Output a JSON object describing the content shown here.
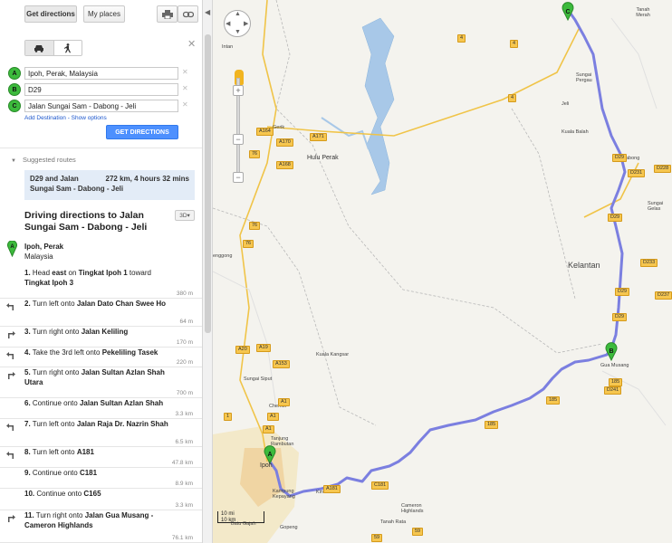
{
  "toolbar": {
    "get_directions_label": "Get directions",
    "my_places_label": "My places"
  },
  "waypoints": [
    {
      "marker": "A",
      "value": "Ipoh, Perak, Malaysia"
    },
    {
      "marker": "B",
      "value": "D29"
    },
    {
      "marker": "C",
      "value": "Jalan Sungai Sam - Dabong - Jeli"
    }
  ],
  "links": {
    "add_destination": "Add Destination",
    "separator": " - ",
    "show_options": "Show options"
  },
  "get_directions_button": "GET DIRECTIONS",
  "suggested": {
    "heading": "Suggested routes",
    "route_name_1": "D29 and Jalan",
    "route_name_2": "Sungai Sam - Dabong - Jeli",
    "route_summary": "272 km, 4 hours 32 mins"
  },
  "directions": {
    "title": "Driving directions to Jalan Sungai Sam - Dabong - Jeli",
    "btn_3d": "3D",
    "start_name": "Ipoh, Perak",
    "start_country": "Malaysia"
  },
  "steps": [
    {
      "num": "1.",
      "html_a": "Head ",
      "b1": "east",
      "html_b": " on ",
      "b2": "Tingkat Ipoh 1",
      "html_c": " toward ",
      "b3": "Tingkat Ipoh 3",
      "dist": "380 m",
      "icon": "none-icon"
    },
    {
      "num": "2.",
      "html_a": "Turn left onto ",
      "b1": "Jalan Dato Chan Swee Ho",
      "dist": "64 m",
      "icon": "turn-left-icon"
    },
    {
      "num": "3.",
      "html_a": "Turn right onto ",
      "b1": "Jalan Keliling",
      "dist": "170 m",
      "icon": "turn-right-icon"
    },
    {
      "num": "4.",
      "html_a": "Take the 3rd left onto ",
      "b1": "Pekeliling Tasek",
      "dist": "220 m",
      "icon": "turn-left-icon"
    },
    {
      "num": "5.",
      "html_a": "Turn right onto ",
      "b1": "Jalan Sultan Azlan Shah Utara",
      "dist": "700 m",
      "icon": "turn-right-icon"
    },
    {
      "num": "6.",
      "html_a": "Continue onto ",
      "b1": "Jalan Sultan Azlan Shah",
      "dist": "3.3 km",
      "icon": "none-icon"
    },
    {
      "num": "7.",
      "html_a": "Turn left onto ",
      "b1": "Jalan Raja Dr. Nazrin Shah",
      "dist": "6.5 km",
      "icon": "turn-left-icon"
    },
    {
      "num": "8.",
      "html_a": "Turn left onto ",
      "b1": "A181",
      "dist": "47.8 km",
      "icon": "turn-left-icon"
    },
    {
      "num": "9.",
      "html_a": "Continue onto ",
      "b1": "C181",
      "dist": "8.9 km",
      "icon": "none-icon"
    },
    {
      "num": "10.",
      "html_a": "Continue onto ",
      "b1": "C165",
      "dist": "3.3 km",
      "icon": "none-icon"
    },
    {
      "num": "11.",
      "html_a": "Turn right onto ",
      "b1": "Jalan Gua Musang - Cameron Highlands",
      "dist": "76.1 km",
      "icon": "turn-right-icon"
    }
  ],
  "map": {
    "labels": {
      "kelantan": "Kelantan",
      "hulu_perak": "Hulu Perak",
      "kuala_kangsar": "Kuala Kangsar",
      "tanah_merah": "Tanah Merah",
      "jeli": "Jeli",
      "sungai_pergau": "Sungai Pergau",
      "kuala_balah": "Kuala Balah",
      "dabong": "Dabong",
      "sungai_gelas": "Sungai Gelas",
      "gua_musang": "Gua Musang",
      "gerik": "Gerik",
      "intan": "Intan",
      "sungai_siput": "Sungai Siput",
      "chemor": "Chemor",
      "tanjung_rambutan": "Tanjung Rambutan",
      "ipoh": "Ipoh",
      "kampung_kepayang": "Kampung Kepayang",
      "kinta": "Kinta",
      "cameron_highlands": "Cameron Highlands",
      "tanah_rata": "Tanah Rata",
      "gopeng": "Gopeng",
      "batu_gajah": "Batu Gajah",
      "enggong": "enggong"
    },
    "shields": [
      "4",
      "4",
      "4",
      "A164",
      "A170",
      "A171",
      "A168",
      "76",
      "76",
      "76",
      "A20",
      "A19",
      "A153",
      "A1",
      "A1",
      "A1",
      "A181",
      "C181",
      "185",
      "185",
      "185",
      "D231",
      "D228",
      "D29",
      "D29",
      "D29",
      "D29",
      "D233",
      "D237",
      "D241",
      "59",
      "59",
      "1"
    ],
    "markers": [
      "A",
      "B",
      "C"
    ],
    "scale_mi": "10 mi",
    "scale_km": "10 km",
    "zoom_plus": "+",
    "zoom_minus": "−"
  },
  "colors": {
    "route": "#7b7fe0",
    "marker_green": "#3cba3c",
    "button_blue": "#4d90fe",
    "water": "#a8c8e8",
    "link_blue": "#1a55cc"
  }
}
